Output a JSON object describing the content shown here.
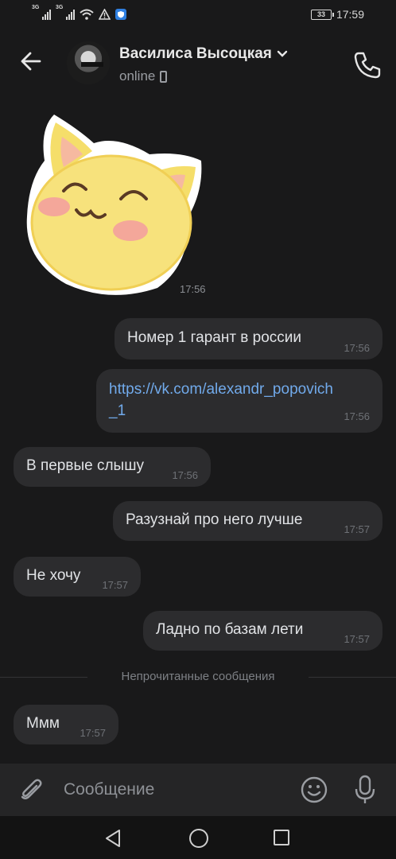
{
  "status_bar": {
    "sim1": "3G",
    "sim2": "3G",
    "battery": "33",
    "time": "17:59",
    "icons": [
      "signal-icon",
      "signal-icon",
      "wifi-icon",
      "warning-icon",
      "shield-icon"
    ]
  },
  "header": {
    "name": "Василиса Высоцкая",
    "status": "online",
    "icons": [
      "back-arrow-icon",
      "chevron-down-icon",
      "mobile-device-icon",
      "phone-icon"
    ]
  },
  "messages": [
    {
      "type": "sticker",
      "side": "in",
      "time": "17:56",
      "sticker": "cat-face-sticker"
    },
    {
      "type": "text",
      "side": "out",
      "text": "Номер 1 гарант в россии",
      "time": "17:56"
    },
    {
      "type": "link",
      "side": "out",
      "line1": "https://vk.com/alexandr_popovich",
      "line2": "_1",
      "time": "17:56"
    },
    {
      "type": "text",
      "side": "in",
      "text": "В первые слышу",
      "time": "17:56"
    },
    {
      "type": "text",
      "side": "out",
      "text": "Разузнай про него лучше",
      "time": "17:57"
    },
    {
      "type": "text",
      "side": "in",
      "text": "Не хочу",
      "time": "17:57"
    },
    {
      "type": "text",
      "side": "out",
      "text": "Ладно по базам лети",
      "time": "17:57"
    },
    {
      "type": "text",
      "side": "in",
      "text": "Ммм",
      "time": "17:57"
    }
  ],
  "unread_divider": "Непрочитанные сообщения",
  "composer": {
    "placeholder": "Сообщение",
    "icons": [
      "paperclip-icon",
      "smile-icon",
      "microphone-icon"
    ]
  },
  "colors": {
    "background": "#19191a",
    "bubble": "#2c2c2e",
    "link": "#71aaeb",
    "composer": "#252526"
  }
}
